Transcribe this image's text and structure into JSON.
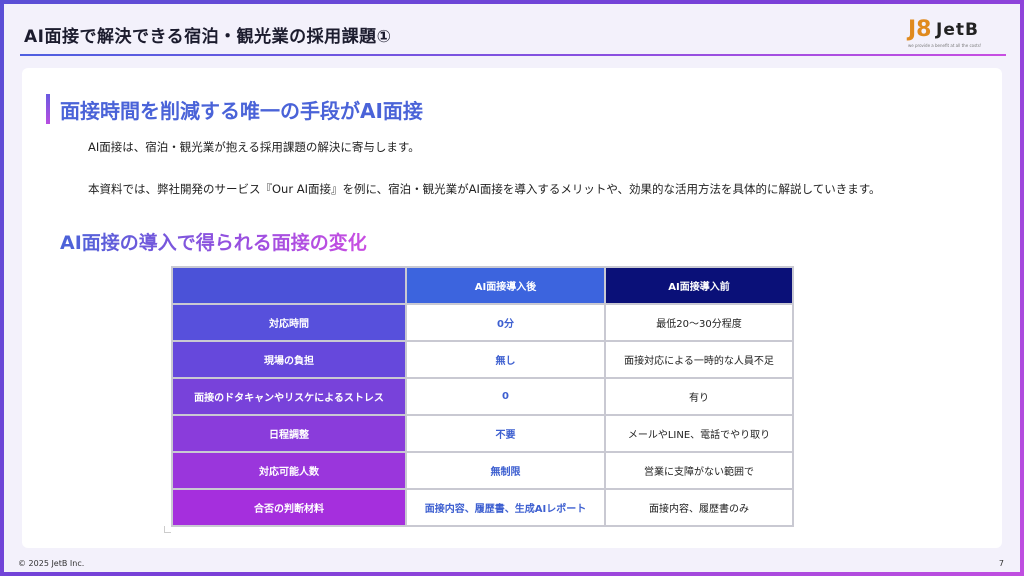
{
  "header": {
    "title": "AI面接で解決できる宿泊・観光業の採用課題①",
    "logo": {
      "mark": "J8",
      "text": "JetB",
      "tagline": "we provide a benefit at all the costs!"
    }
  },
  "section": {
    "heading": "面接時間を削減する唯一の手段がAI面接",
    "paragraph1": "AI面接は、宿泊・観光業が抱える採用課題の解決に寄与します。",
    "paragraph2": "本資料では、弊社開発のサービス『Our AI面接』を例に、宿泊・観光業がAI面接を導入するメリットや、効果的な活用方法を具体的に解説していきます。"
  },
  "comparison": {
    "heading": "AI面接の導入で得られる面接の変化",
    "columns": [
      "AI面接導入後",
      "AI面接導入前"
    ],
    "rows": [
      {
        "label": "対応時間",
        "after": "0分",
        "before": "最低20〜30分程度"
      },
      {
        "label": "現場の負担",
        "after": "無し",
        "before": "面接対応による一時的な人員不足"
      },
      {
        "label": "面接のドタキャンやリスケによるストレス",
        "after": "0",
        "before": "有り"
      },
      {
        "label": "日程調整",
        "after": "不要",
        "before": "メールやLINE、電話でやり取り"
      },
      {
        "label": "対応可能人数",
        "after": "無制限",
        "before": "営業に支障がない範囲で"
      },
      {
        "label": "合否の判断材料",
        "after": "面接内容、履歴書、生成AIレポート",
        "before": "面接内容、履歴書のみ"
      }
    ]
  },
  "footer": {
    "copyright": "© 2025 JetB Inc.",
    "page_number": "7"
  },
  "colors": {
    "accent_blue": "#4a63d8",
    "accent_purple": "#a52fdd",
    "navy": "#0a1078"
  }
}
